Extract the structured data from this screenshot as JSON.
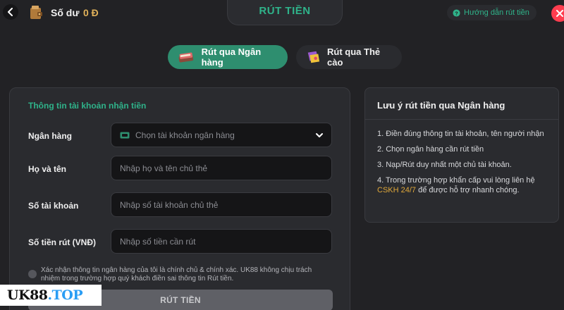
{
  "header": {
    "balance_label": "Số dư",
    "balance_value": "0 Đ",
    "title": "RÚT TIỀN",
    "guide_label": "Hướng dẫn rút tiền"
  },
  "tabs": [
    {
      "label": "Rút qua Ngân hàng",
      "active": true
    },
    {
      "label": "Rút qua Thẻ cào",
      "active": false
    }
  ],
  "form": {
    "section_title": "Thông tin tài khoản nhận tiền",
    "bank_label": "Ngân hàng",
    "bank_placeholder": "Chọn tài khoản ngân hàng",
    "name_label": "Họ và tên",
    "name_placeholder": "Nhập họ và tên chủ thẻ",
    "account_label": "Số tài khoản",
    "account_placeholder": "Nhập số tài khoản chủ thẻ",
    "amount_label": "Số tiền rút (VNĐ)",
    "amount_placeholder": "Nhập số tiền cần rút",
    "confirm_text": "Xác nhận thông tin ngân hàng của tôi là chính chủ & chính xác. UK88 không chịu trách nhiệm trong trường hợp quý khách điền sai thông tin Rút tiền.",
    "submit_label": "RÚT TIỀN"
  },
  "notes": {
    "title": "Lưu ý rút tiền qua Ngân hàng",
    "item1": "1. Điền đúng thông tin tài khoản, tên người nhận",
    "item2": "2. Chọn ngân hàng cần rút tiền",
    "item3": "3. Nạp/Rút duy nhất một chủ tài khoản.",
    "item4_prefix": "4. Trong trường hợp khẩn cấp vui lòng liên hệ ",
    "item4_link": "CSKH 24/7",
    "item4_suffix": " để được hỗ trợ nhanh chóng."
  },
  "watermark": {
    "text_main": "UK88",
    "text_suffix": ".TOP"
  },
  "icons": {
    "back": "chevron-left-icon",
    "wallet": "wallet-icon",
    "help": "question-circle-icon",
    "close": "close-icon",
    "bank": "book-icon",
    "card": "card-icon",
    "select_card": "card-icon",
    "dropdown": "chevron-down-icon"
  },
  "colors": {
    "accent": "#2fb38a",
    "active_tab": "#2e8e6f",
    "balance": "#e0b15a",
    "close": "#ff3d4f",
    "highlight": "#e0a83a"
  }
}
